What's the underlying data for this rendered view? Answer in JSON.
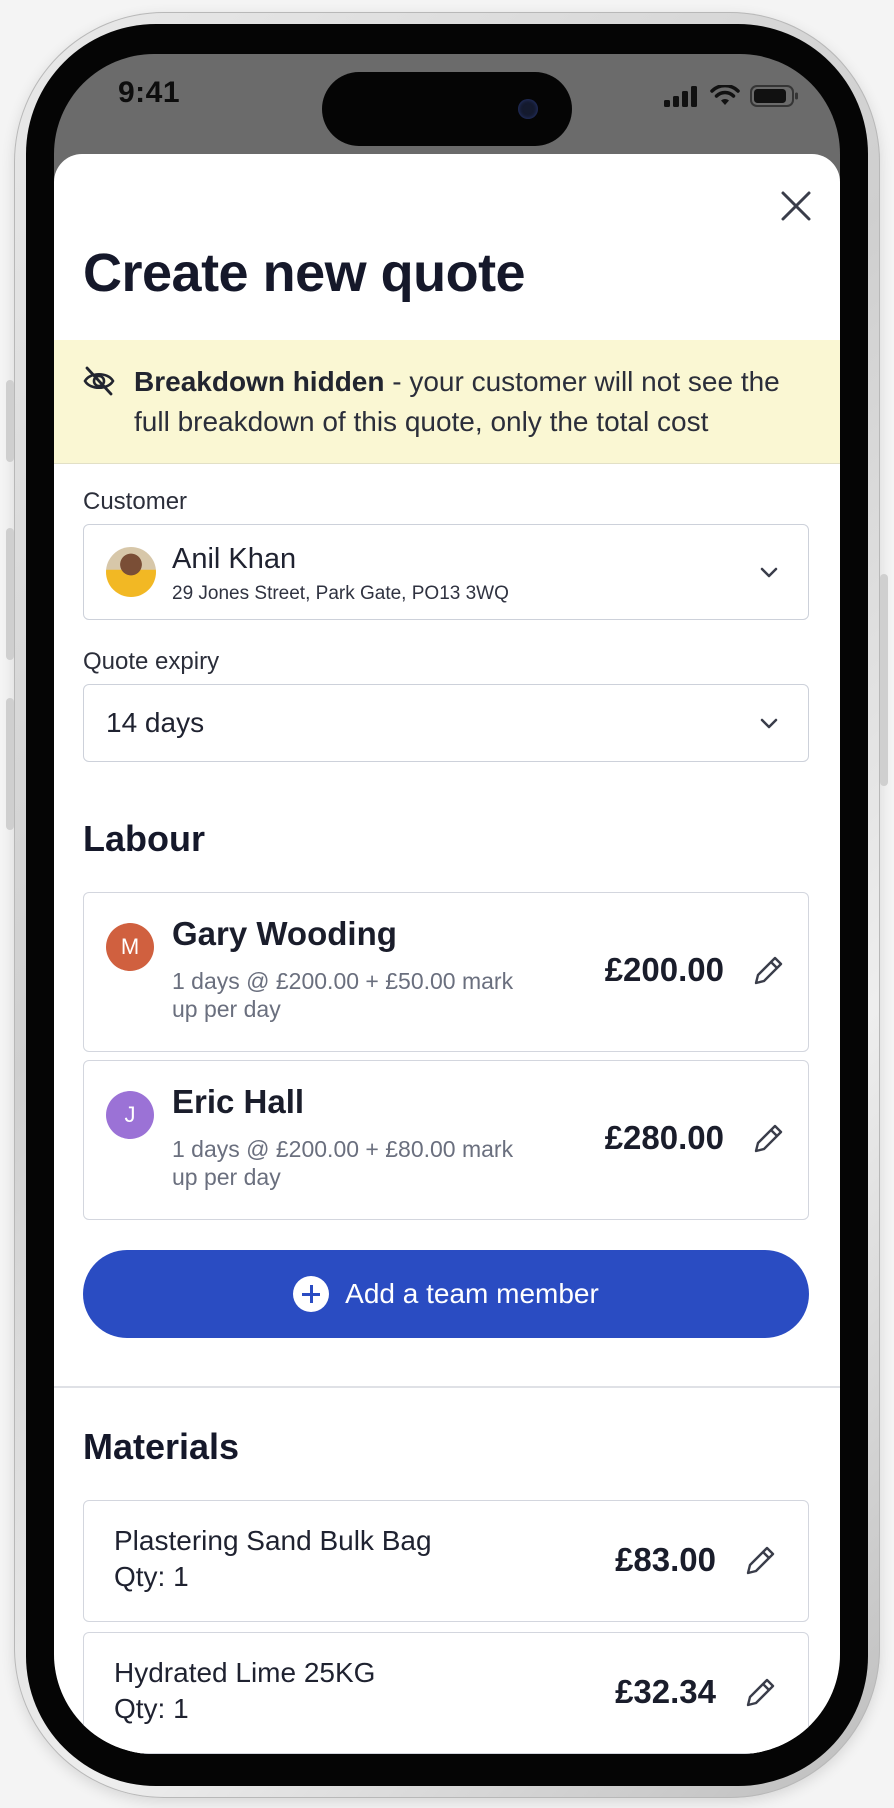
{
  "status_bar": {
    "time": "9:41"
  },
  "modal": {
    "title": "Create new quote"
  },
  "banner": {
    "bold": "Breakdown hidden",
    "text": " - your customer will not see the full breakdown of this quote, only the total cost"
  },
  "customer": {
    "label": "Customer",
    "name": "Anil Khan",
    "address": "29 Jones Street, Park Gate, PO13 3WQ"
  },
  "quote_expiry": {
    "label": "Quote expiry",
    "value": "14 days"
  },
  "labour": {
    "heading": "Labour",
    "members": [
      {
        "initial": "M",
        "name": "Gary Wooding",
        "detail": "1 days @ £200.00 + £50.00 mark up per day",
        "price": "£200.00",
        "avatar_color": "#d0603f"
      },
      {
        "initial": "J",
        "name": "Eric Hall",
        "detail": "1 days @ £200.00 + £80.00 mark up per day",
        "price": "£280.00",
        "avatar_color": "#9b72d6"
      }
    ],
    "add_button": "Add a team member"
  },
  "materials": {
    "heading": "Materials",
    "items": [
      {
        "name": "Plastering Sand Bulk Bag",
        "qty": "Qty: 1",
        "price": "£83.00"
      },
      {
        "name": "Hydrated Lime 25KG",
        "qty": "Qty: 1",
        "price": "£32.34"
      }
    ]
  },
  "colors": {
    "primary": "#2a4cc2",
    "banner_bg": "#faf7d3"
  }
}
